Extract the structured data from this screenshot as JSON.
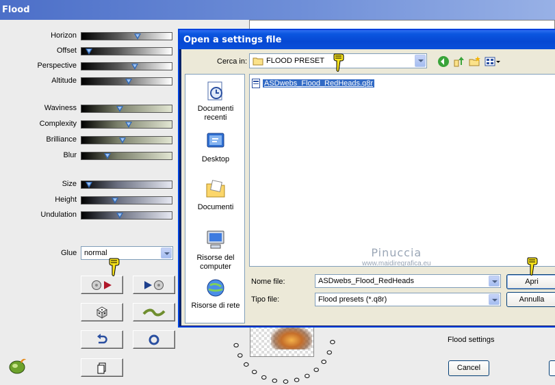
{
  "window": {
    "title": "Flood"
  },
  "sliders": [
    {
      "label": "Horizon",
      "value": 0.6,
      "style": "dark"
    },
    {
      "label": "Offset",
      "value": 0.05,
      "style": "dark"
    },
    {
      "label": "Perspective",
      "value": 0.57,
      "style": "dark"
    },
    {
      "label": "Altitude",
      "value": 0.5,
      "style": "dark"
    },
    {
      "label": "Waviness",
      "value": 0.4,
      "style": "green"
    },
    {
      "label": "Complexity",
      "value": 0.5,
      "style": "green"
    },
    {
      "label": "Brilliance",
      "value": 0.43,
      "style": "green"
    },
    {
      "label": "Blur",
      "value": 0.26,
      "style": "green"
    },
    {
      "label": "Size",
      "value": 0.05,
      "style": "blue"
    },
    {
      "label": "Height",
      "value": 0.34,
      "style": "blue"
    },
    {
      "label": "Undulation",
      "value": 0.4,
      "style": "blue"
    }
  ],
  "glue": {
    "label": "Glue",
    "value": "normal"
  },
  "settings_label": "Flood settings",
  "cancel_label": "Cancel",
  "dialog": {
    "title": "Open a settings file",
    "look_in_label": "Cerca in:",
    "look_in_value": "FLOOD PRESET",
    "places": [
      {
        "label": "Documenti recenti",
        "icon": "recent-documents-icon"
      },
      {
        "label": "Desktop",
        "icon": "desktop-icon"
      },
      {
        "label": "Documenti",
        "icon": "documents-folder-icon"
      },
      {
        "label": "Risorse del computer",
        "icon": "my-computer-icon"
      },
      {
        "label": "Risorse di rete",
        "icon": "network-icon"
      }
    ],
    "files": [
      {
        "name": "ASDwebs_Flood_RedHeads.q8r",
        "selected": true
      }
    ],
    "watermark": {
      "line1": "Pinuccia",
      "line2": "www.maidiregrafica.eu"
    },
    "file_name_label": "Nome file:",
    "file_name_value": "ASDwebs_Flood_RedHeads",
    "file_type_label": "Tipo file:",
    "file_type_value": "Flood presets (*.q8r)",
    "open_label": "Apri",
    "cancel_label": "Annulla"
  },
  "colors": {
    "title_blue": "#0b56e0",
    "selection": "#316ac5",
    "thumb": "#2f67b5"
  }
}
